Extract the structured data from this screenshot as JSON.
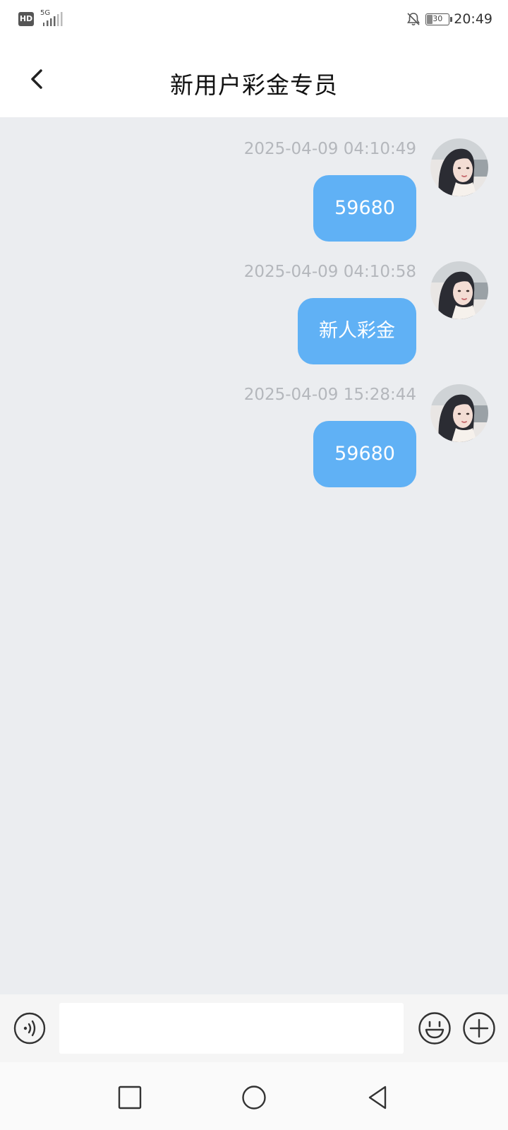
{
  "status_bar": {
    "hd_label": "HD",
    "network_label": "5G",
    "battery_level": "30",
    "time": "20:49",
    "icons": [
      "signal-icon",
      "bell-off-icon",
      "battery-icon"
    ]
  },
  "header": {
    "title": "新用户彩金专员",
    "back_icon": "chevron-left-icon"
  },
  "messages": [
    {
      "time": "2025-04-09 04:10:49",
      "text": "59680"
    },
    {
      "time": "2025-04-09 04:10:58",
      "text": "新人彩金"
    },
    {
      "time": "2025-04-09 15:28:44",
      "text": "59680"
    }
  ],
  "input_bar": {
    "value": "",
    "icons": [
      "voice-icon",
      "emoji-icon",
      "plus-icon"
    ]
  },
  "nav_bar": {
    "icons": [
      "recent-apps-icon",
      "home-icon",
      "back-triangle-icon"
    ]
  },
  "colors": {
    "chat_background": "#ebedf0",
    "bubble": "#60b1f5",
    "bubble_text": "#ffffff",
    "timestamp": "#b4b7bc"
  }
}
